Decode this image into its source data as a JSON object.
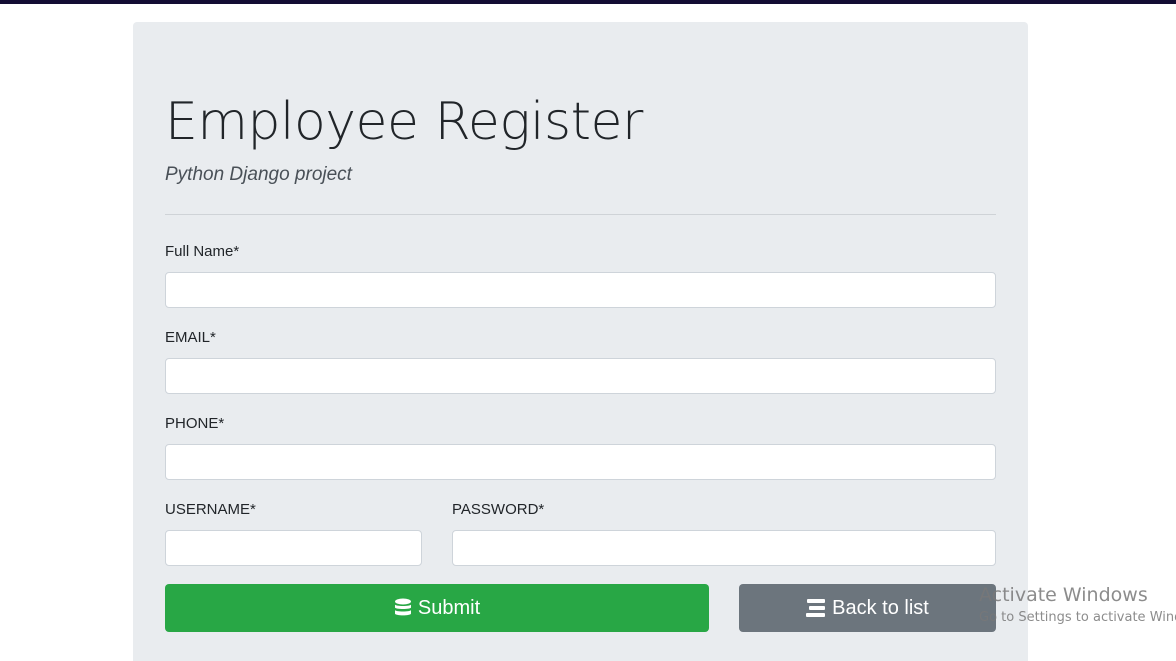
{
  "header": {
    "title": "Employee Register",
    "subtitle": "Python Django project"
  },
  "form": {
    "full_name_label": "Full Name*",
    "full_name_value": "",
    "email_label": "EMAIL*",
    "email_value": "",
    "phone_label": "PHONE*",
    "phone_value": "",
    "username_label": "USERNAME*",
    "username_value": "",
    "password_label": "PASSWORD*",
    "password_value": ""
  },
  "buttons": {
    "submit_label": "Submit",
    "submit_icon": "database-icon",
    "back_label": "Back to list",
    "back_icon": "list-icon"
  },
  "watermark": {
    "title": "Activate Windows",
    "subtitle": "Go to Settings to activate Windows."
  },
  "colors": {
    "top_bar": "#130d33",
    "card_bg": "#e9ecef",
    "submit_bg": "#28a745",
    "back_bg": "#6c757d"
  }
}
